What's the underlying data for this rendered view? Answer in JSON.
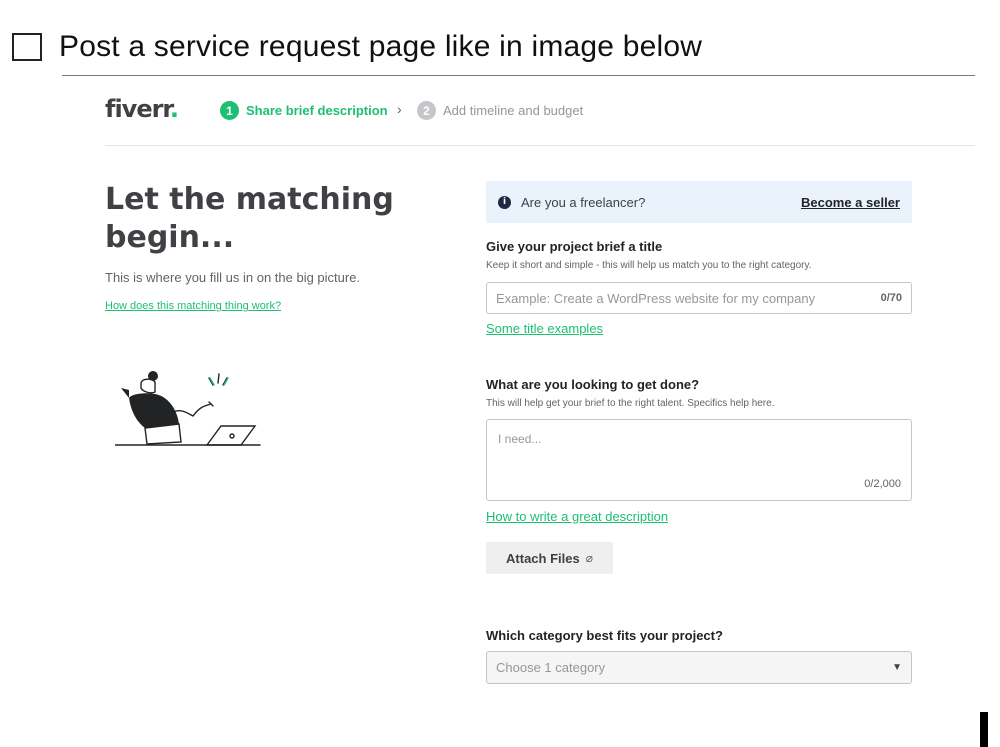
{
  "task": {
    "text": "Post a service request page like in image below"
  },
  "header": {
    "logo_text": "fiverr",
    "logo_dot": ".",
    "steps": [
      {
        "number": "1",
        "label": "Share brief description"
      },
      {
        "number": "2",
        "label": "Add timeline and budget"
      }
    ],
    "separator": "›"
  },
  "hero": {
    "title": "Let the matching begin...",
    "subtitle": "This is where you fill us in on the big picture.",
    "link": "How does this matching thing work?"
  },
  "banner": {
    "icon": "info-icon",
    "text": "Are you a freelancer?",
    "link": "Become a seller"
  },
  "title_field": {
    "label": "Give your project brief a title",
    "help": "Keep it short and simple - this will help us match you to the right category.",
    "placeholder": "Example: Create a WordPress website for my company",
    "counter": "0/70",
    "examples_link": "Some title examples"
  },
  "description_field": {
    "label": "What are you looking to get done?",
    "help": "This will help get your brief to the right talent. Specifics help here.",
    "placeholder": "I need...",
    "counter": "0/2,000",
    "guide_link": "How to write a great description"
  },
  "attach": {
    "label": "Attach Files",
    "icon": "paperclip-icon"
  },
  "category": {
    "label": "Which category best fits your project?",
    "placeholder": "Choose 1 category",
    "icon": "chevron-down-icon"
  },
  "colors": {
    "brand_green": "#1dbf73",
    "banner_bg": "#eaf2fc",
    "text_dark": "#404145"
  }
}
